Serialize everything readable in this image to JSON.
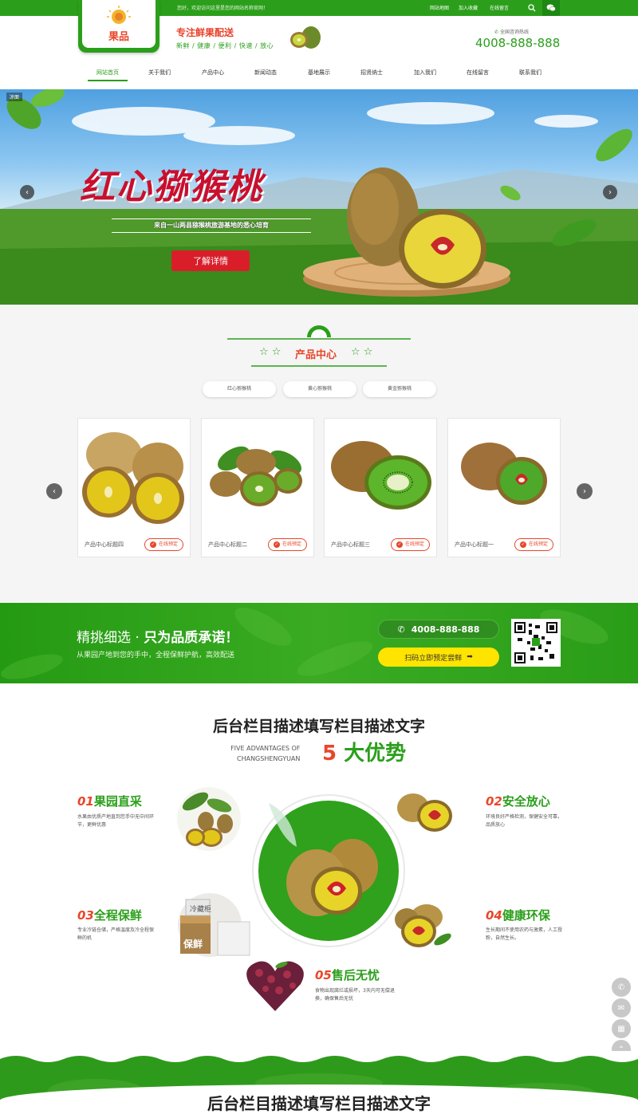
{
  "topbar": {
    "welcome": "您好，欢迎访问这里是您的网站名称官网！",
    "links": [
      "网站地图",
      "加入收藏",
      "在线留言"
    ]
  },
  "header": {
    "logo_text": "果品",
    "slogan_title": "专注鲜果配送",
    "slogan_sub": "新鲜 / 健康 / 便利 / 快速 / 放心",
    "hotline_label": "全国咨询热线",
    "hotline": "4008-888-888"
  },
  "nav": {
    "items": [
      "网站首页",
      "关于我们",
      "产品中心",
      "新闻动态",
      "基地展示",
      "招贤纳士",
      "加入我们",
      "在线留言",
      "联系我们"
    ]
  },
  "banner": {
    "tag": "凉面",
    "title": "红心猕猴桃",
    "subtitle": "来自一山两县猕猴桃旅游基地的悉心培育",
    "button": "了解详情",
    "prev": "‹",
    "next": "›"
  },
  "products": {
    "title": "产品中心",
    "tabs": [
      "红心猕猴桃",
      "黄心猕猴桃",
      "黄金猕猴桃"
    ],
    "cards": [
      {
        "name": "产品中心标题四",
        "book": "在线预定"
      },
      {
        "name": "产品中心标题二",
        "book": "在线预定"
      },
      {
        "name": "产品中心标题三",
        "book": "在线预定"
      },
      {
        "name": "产品中心标题一",
        "book": "在线预定"
      }
    ]
  },
  "band": {
    "line1_a": "精挑细选 · ",
    "line1_b": "只为品质承诺！",
    "line2": "从果园产地到您的手中，全程保鲜护航，高效配送",
    "phone": "4008-888-888",
    "cta": "扫码立即预定尝鲜"
  },
  "advantages": {
    "title": "后台栏目描述填写栏目描述文字",
    "en1": "FIVE ADVANTAGES OF",
    "en2": "CHANGSHENGYUAN",
    "big_num": "5",
    "big_text": " 大优势",
    "items": [
      {
        "num": "01",
        "title": "果园直采",
        "desc": "水果由优质产地直到您手中无中间环节，更鲜优惠"
      },
      {
        "num": "02",
        "title": "安全放心",
        "desc": "环境良好严格检测，保健安全可靠，品质放心"
      },
      {
        "num": "03",
        "title": "全程保鲜",
        "desc": "专业冷链仓储，严格温度及冷全程保鲜的机"
      },
      {
        "num": "04",
        "title": "健康环保",
        "desc": "生长期间不使用农药与激素，人工授粉，自然生长。"
      },
      {
        "num": "05",
        "title": "售后无忧",
        "desc": "食物出现腐烂或损坏，3天内可无偿退换，确保售后无忧"
      }
    ],
    "box_label1": "冷藏柜",
    "box_label2": "保鲜"
  },
  "footer": {
    "title": "后台栏目描述填写栏目描述文字"
  },
  "colors": {
    "green": "#2b9f1b",
    "red": "#e8472a",
    "yellow": "#ffe400"
  }
}
